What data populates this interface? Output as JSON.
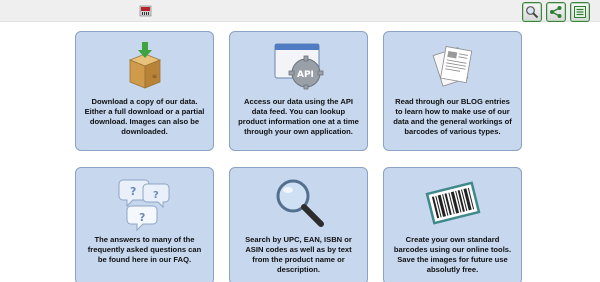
{
  "toolbar": {
    "buttons": [
      {
        "name": "search-icon"
      },
      {
        "name": "share-icon"
      },
      {
        "name": "barcode-list-icon"
      }
    ]
  },
  "cards": [
    {
      "id": "download",
      "icon": "download-box-icon",
      "text": "Download a copy of our data. Either a full download or a partial download. Images can also be downloaded."
    },
    {
      "id": "api",
      "icon": "api-gear-icon",
      "text": "Access our data using the API data feed. You can lookup product information one at a time through your own application."
    },
    {
      "id": "blog",
      "icon": "blog-papers-icon",
      "text": "Read through our BLOG entries to learn how to make use of our data and the general workings of barcodes of various types."
    },
    {
      "id": "faq",
      "icon": "faq-bubbles-icon",
      "text": "The answers to many of the frequently asked questions can be found here in our FAQ."
    },
    {
      "id": "search",
      "icon": "magnifier-icon",
      "text": "Search by UPC, EAN, ISBN or ASIN codes as well as by text from the product name or description."
    },
    {
      "id": "create",
      "icon": "barcode-icon",
      "text": "Create your own standard barcodes using our online tools. Save the images for future use absolutly free."
    }
  ]
}
